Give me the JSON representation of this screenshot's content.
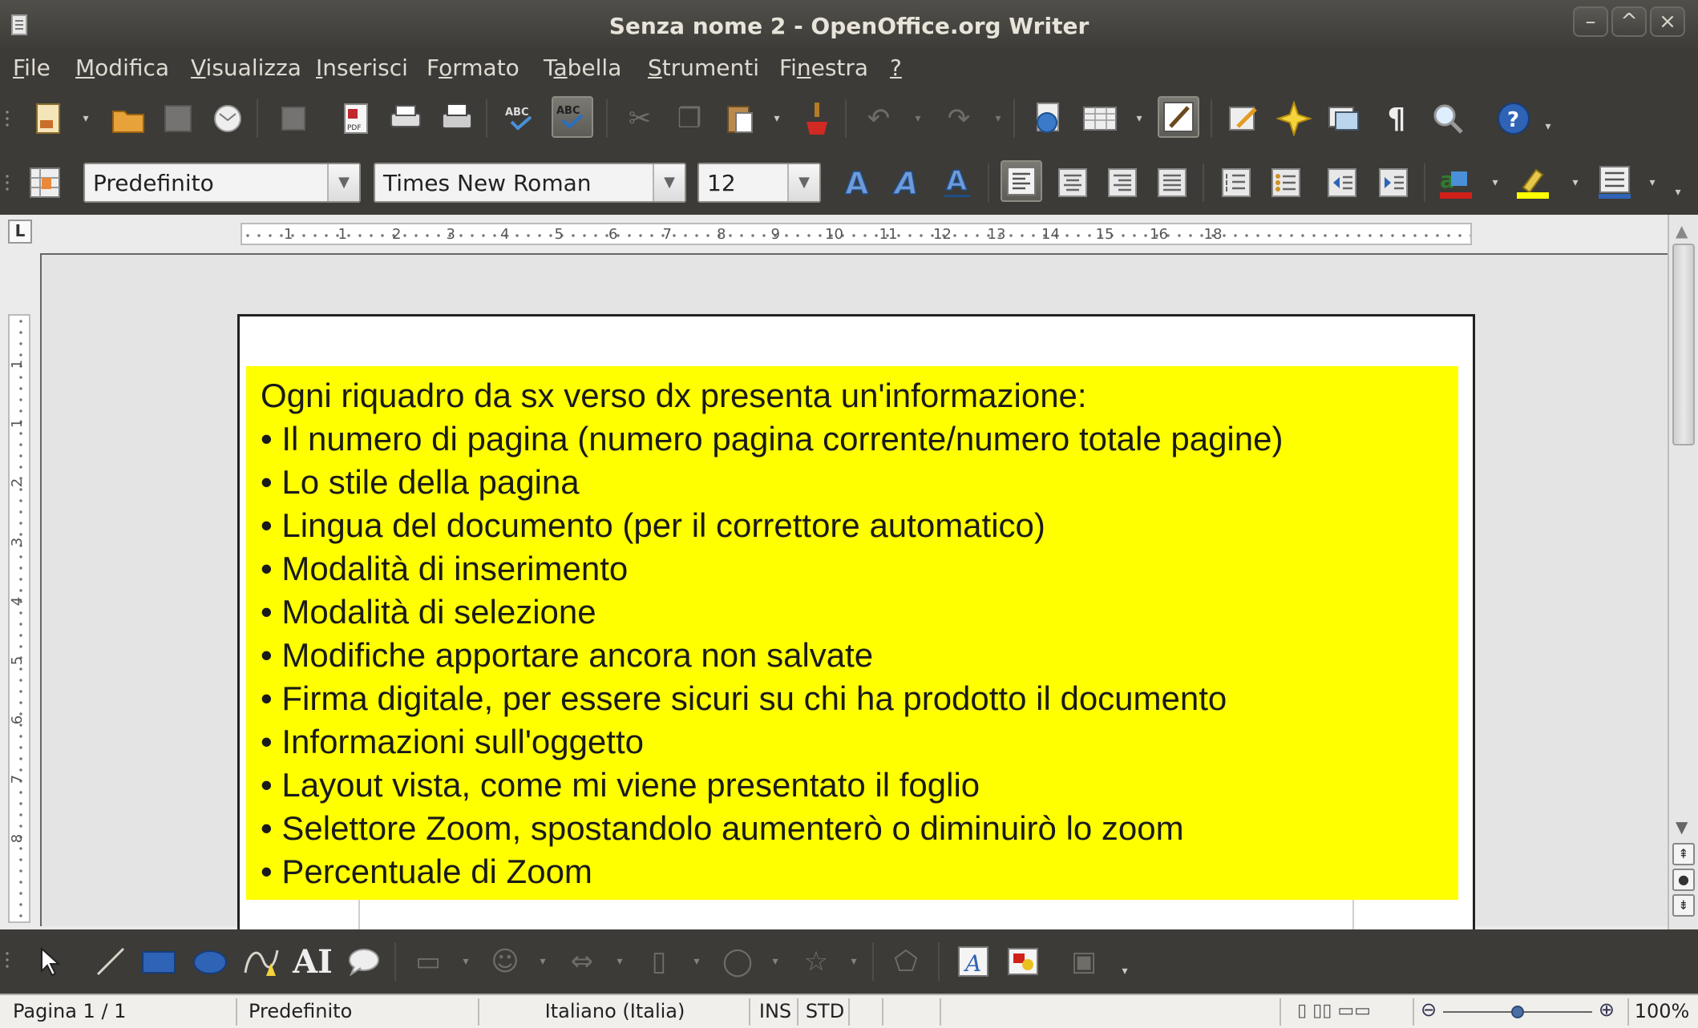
{
  "window": {
    "title": "Senza nome 2 - OpenOffice.org Writer",
    "controls": [
      "–",
      "^",
      "×"
    ]
  },
  "menu": [
    {
      "pre": "",
      "u": "F",
      "post": "ile"
    },
    {
      "pre": "",
      "u": "M",
      "post": "odifica"
    },
    {
      "pre": "",
      "u": "V",
      "post": "isualizza"
    },
    {
      "pre": "",
      "u": "I",
      "post": "nserisci"
    },
    {
      "pre": "F",
      "u": "o",
      "post": "rmato"
    },
    {
      "pre": "T",
      "u": "a",
      "post": "bella"
    },
    {
      "pre": "",
      "u": "S",
      "post": "trumenti"
    },
    {
      "pre": "Fi",
      "u": "n",
      "post": "estra"
    },
    {
      "pre": "",
      "u": "?",
      "post": ""
    }
  ],
  "formatting": {
    "paragraph_style": "Predefinito",
    "font_name": "Times New Roman",
    "font_size": "12"
  },
  "ruler": {
    "h_ticks": [
      "1",
      "1",
      "2",
      "3",
      "4",
      "5",
      "6",
      "7",
      "8",
      "9",
      "10",
      "11",
      "12",
      "13",
      "14",
      "15",
      "16",
      "18"
    ],
    "v_ticks": [
      "1",
      "1",
      "2",
      "3",
      "4",
      "5",
      "6",
      "7",
      "8"
    ]
  },
  "document": {
    "lines": [
      "Ogni riquadro da sx verso dx presenta un'informazione:",
      "• Il numero di pagina (numero pagina corrente/numero totale pagine)",
      "• Lo stile della pagina",
      "• Lingua del documento (per il correttore automatico)",
      "• Modalità di inserimento",
      "• Modalità di selezione",
      "• Modifiche apportare ancora non salvate",
      "• Firma digitale, per essere sicuri su chi ha prodotto il documento",
      "• Informazioni sull'oggetto",
      "• Layout vista, come mi viene presentato il foglio",
      "• Selettore Zoom, spostandolo aumenterò o diminuirò lo zoom",
      "• Percentuale di Zoom"
    ],
    "highlight_color": "#ffff00"
  },
  "statusbar": {
    "page": "Pagina 1 / 1",
    "page_style": "Predefinito",
    "language": "Italiano (Italia)",
    "insert_mode": "INS",
    "selection_mode": "STD",
    "zoom_percent": "100%",
    "zoom_level": 0.5
  },
  "icons": {
    "toolbar1": [
      "new-document-icon",
      "open-icon",
      "save-icon",
      "email-icon",
      "edit-file-icon",
      "export-pdf-icon",
      "print-icon",
      "print-preview-icon",
      "spellcheck-icon",
      "autospellcheck-icon",
      "cut-icon",
      "copy-icon",
      "paste-icon",
      "format-paintbrush-icon",
      "undo-icon",
      "redo-icon",
      "hyperlink-icon",
      "table-icon",
      "show-draw-functions-icon",
      "find-replace-icon",
      "navigator-icon",
      "gallery-icon",
      "nonprinting-chars-icon",
      "zoom-icon",
      "help-icon"
    ],
    "toolbar2": [
      "styles-icon",
      "bold-icon",
      "italic-icon",
      "underline-icon",
      "align-left-icon",
      "align-center-icon",
      "align-right-icon",
      "justify-icon",
      "numbering-icon",
      "bullets-icon",
      "decrease-indent-icon",
      "increase-indent-icon",
      "font-color-icon",
      "highlight-icon",
      "background-color-icon"
    ],
    "drawbar": [
      "select-icon",
      "line-icon",
      "rectangle-icon",
      "ellipse-icon",
      "freeform-icon",
      "text-icon",
      "callout-icon",
      "basic-shapes-icon",
      "symbol-shapes-icon",
      "block-arrows-icon",
      "flowchart-icon",
      "callouts-icon",
      "stars-icon",
      "points-icon",
      "fontwork-icon",
      "from-file-icon",
      "extrusion-icon"
    ]
  }
}
